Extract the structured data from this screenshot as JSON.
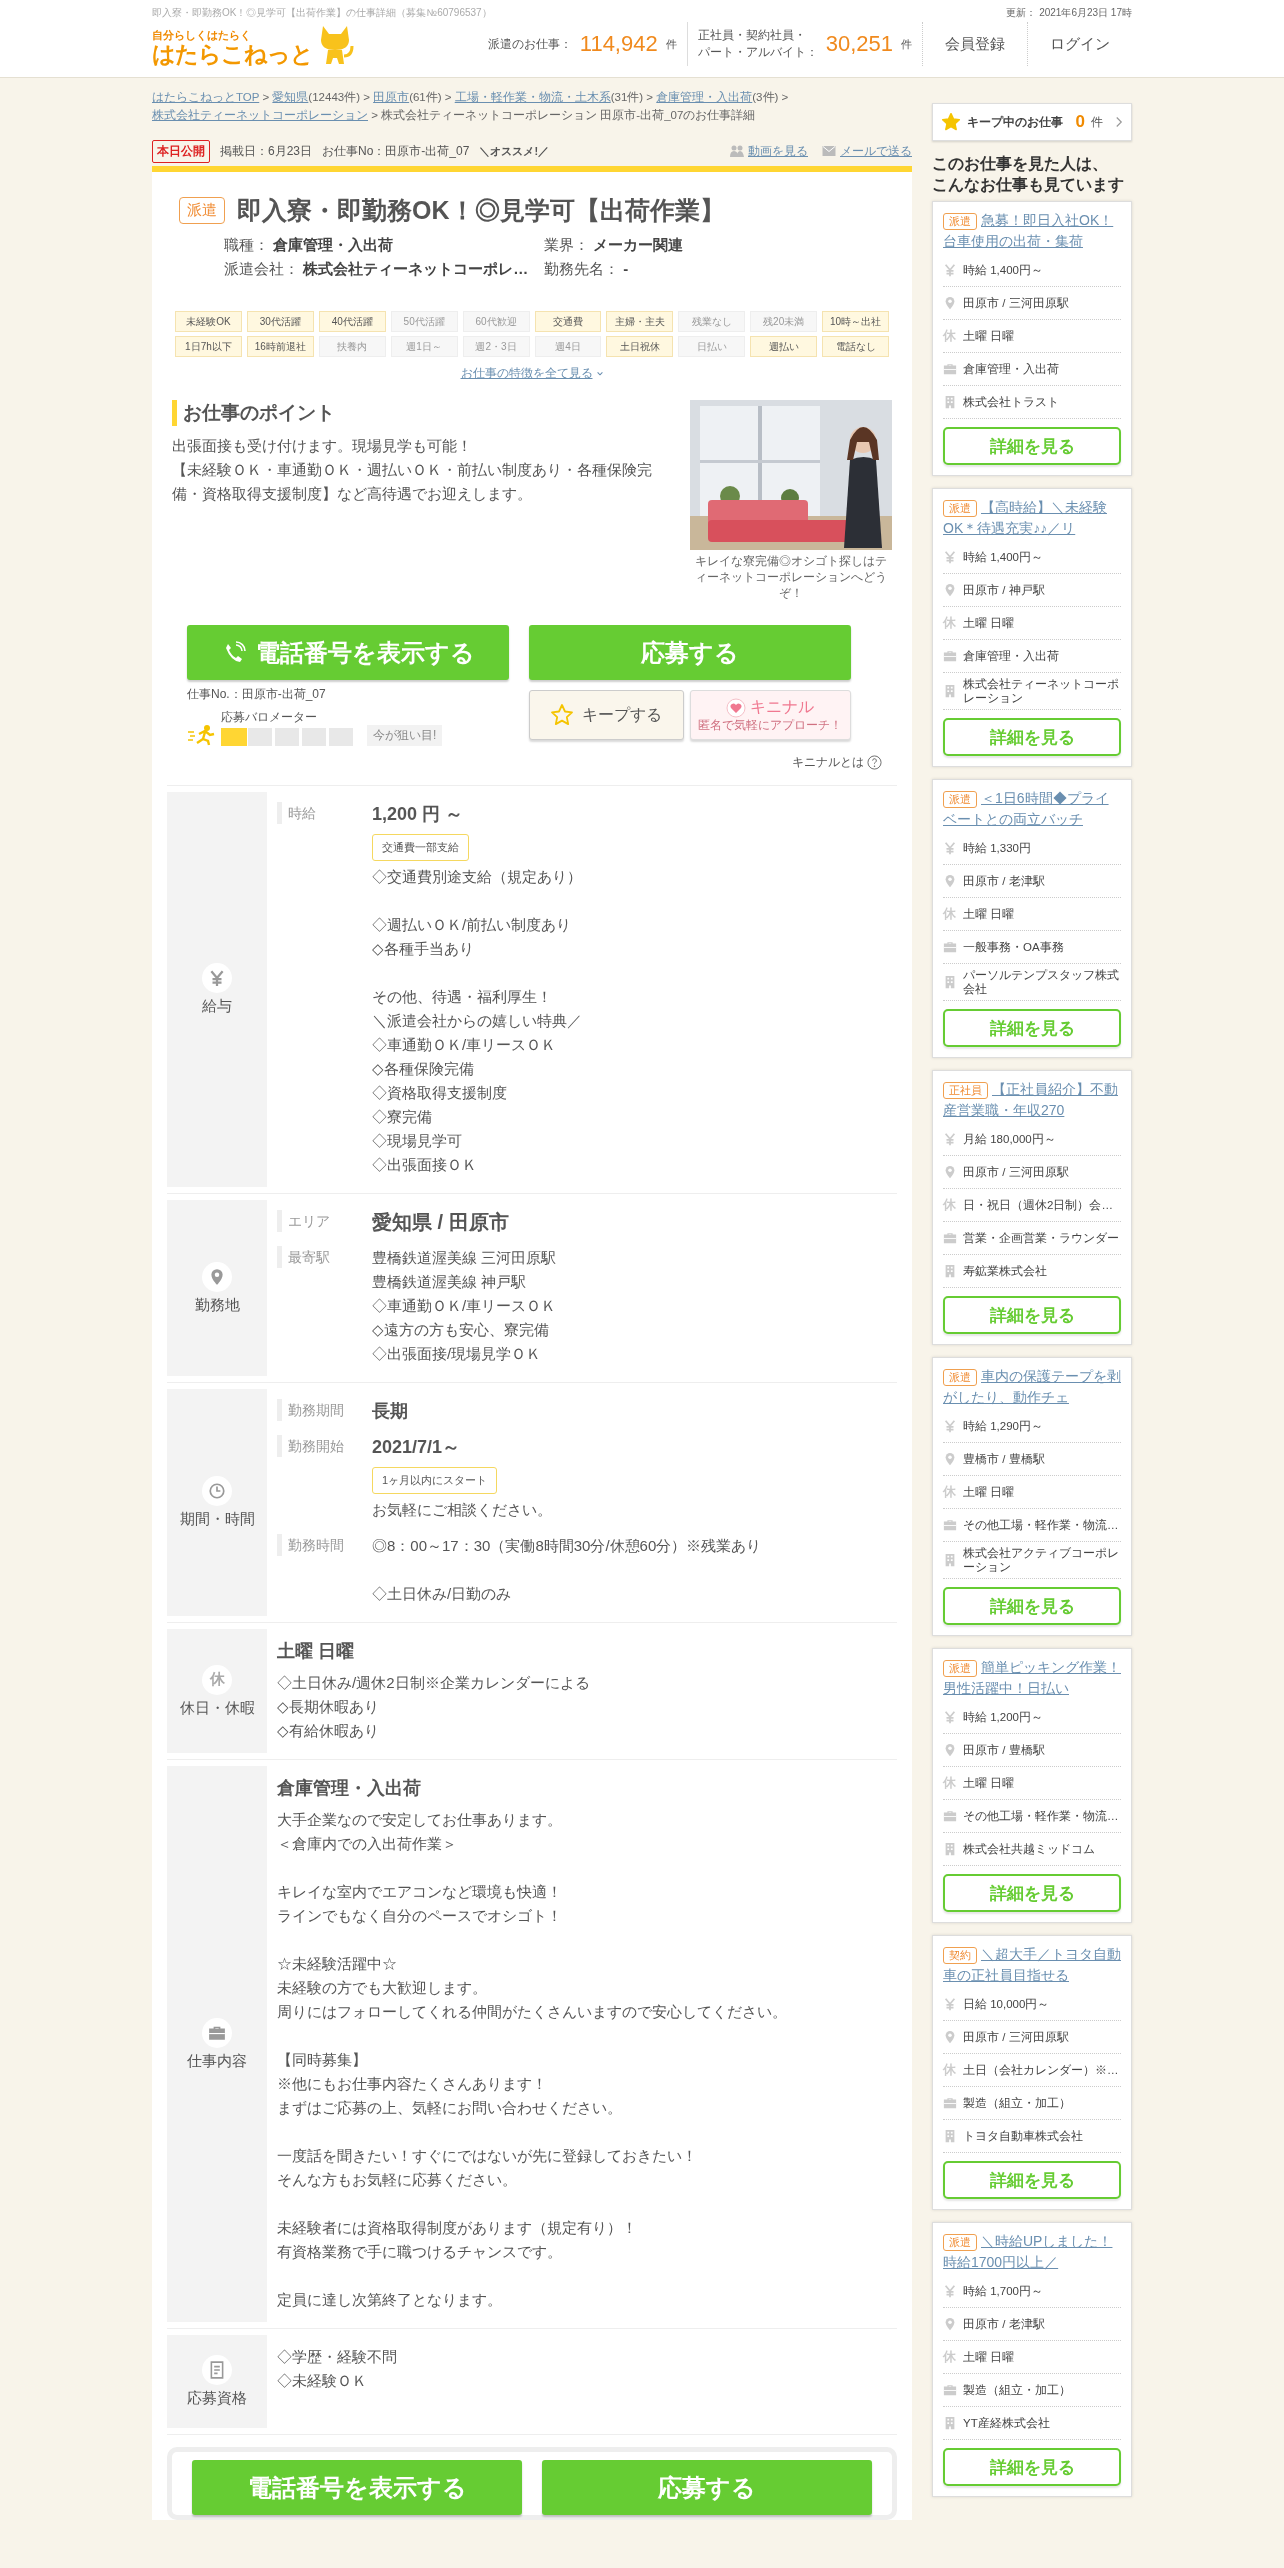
{
  "header": {
    "page_title": "即入寮・即勤務OK！◎見学可【出荷作業】の仕事詳細（募集№60796537）",
    "updated": "更新： 2021年6月23日 17時",
    "logo_tagline": "自分らしくはたらく",
    "logo_name": "はたらこねっと",
    "stats": [
      {
        "label": [
          "派遣のお仕事："
        ],
        "count": "114,942",
        "unit": "件"
      },
      {
        "label": [
          "正社員・契約社員・",
          "パート・アルバイト："
        ],
        "count": "30,251",
        "unit": "件"
      }
    ],
    "buttons": [
      "会員登録",
      "ログイン"
    ]
  },
  "breadcrumb": {
    "separator": ">",
    "links": [
      {
        "label": "はたらこねっとTOP"
      },
      {
        "label": "愛知県",
        "count": "(12443件)"
      },
      {
        "label": "田原市",
        "count": "(61件)"
      },
      {
        "label": "工場・軽作業・物流・土木系",
        "count": "(31件)"
      },
      {
        "label": "倉庫管理・入出荷",
        "count": "(3件)"
      },
      {
        "label": "株式会社ティーネットコーポレーション"
      }
    ],
    "current": "株式会社ティーネットコーポレーション 田原市-出荷_07のお仕事詳細"
  },
  "meta": {
    "badge": "本日公開",
    "posted": "掲載日：6月23日",
    "job_no": "お仕事No：田原市-出荷_07",
    "recommend": "＼オススメ!／",
    "links": [
      {
        "kind": "video",
        "label": "動画を見る"
      },
      {
        "kind": "mail",
        "label": "メールで送る"
      }
    ]
  },
  "job": {
    "tag": "派遣",
    "title": "即入寮・即勤務OK！◎見学可【出荷作業】",
    "fields": [
      {
        "label": "職種：",
        "value": "倉庫管理・入出荷"
      },
      {
        "label": "業界：",
        "value": "メーカー関連"
      },
      {
        "label": "派遣会社：",
        "value": "株式会社ティーネットコーポレ…"
      },
      {
        "label": "勤務先名：",
        "value": "-"
      }
    ],
    "features": [
      {
        "label": "未経験OK",
        "on": true
      },
      {
        "label": "30代活躍",
        "on": true
      },
      {
        "label": "40代活躍",
        "on": true
      },
      {
        "label": "50代活躍",
        "on": false
      },
      {
        "label": "60代歓迎",
        "on": false
      },
      {
        "label": "交通費",
        "on": true
      },
      {
        "label": "主婦・主夫",
        "on": true
      },
      {
        "label": "残業なし",
        "on": false
      },
      {
        "label": "残20未満",
        "on": false
      },
      {
        "label": "10時～出社",
        "on": true
      },
      {
        "label": "1日7h以下",
        "on": true
      },
      {
        "label": "16時前退社",
        "on": true
      },
      {
        "label": "扶養内",
        "on": false
      },
      {
        "label": "週1日～",
        "on": false
      },
      {
        "label": "週2・3日",
        "on": false
      },
      {
        "label": "週4日",
        "on": false
      },
      {
        "label": "土日祝休",
        "on": true
      },
      {
        "label": "日払い",
        "on": false
      },
      {
        "label": "週払い",
        "on": true
      },
      {
        "label": "電話なし",
        "on": true
      }
    ],
    "features_link": "お仕事の特徴を全て見る"
  },
  "points": {
    "heading": "お仕事のポイント",
    "lines": [
      "出張面接も受け付けます。現場見学も可能！",
      "【未経験ＯＫ・車通勤ＯＫ・週払いＯＫ・前払い制度あり・各種保険完備・資格取得支援制度】など高待遇でお迎えします。"
    ],
    "photo": {
      "kind": "picture"
    },
    "caption": "キレイな寮完備◎オシゴト探しはティーネットコーポレーションへどうぞ！"
  },
  "actions": {
    "phone": "電話番号を表示する",
    "apply": "応募する",
    "job_no": "仕事No.：田原市-出荷_07",
    "barometer": {
      "label": "応募バロメーター",
      "level": 0.2,
      "hint": "今が狙い目!"
    },
    "keep": "キープする",
    "kininaru": {
      "label": "キニナル",
      "sub": "匿名で気軽にアプローチ！"
    },
    "help": "キニナルとは"
  },
  "sections": [
    {
      "kind": "salary",
      "title": "給与",
      "rows": [
        {
          "label": "時給",
          "value": "1,200 円 ～",
          "badge": "交通費一部支給",
          "paragraphs": [
            [
              "◇交通費別途支給（規定あり）"
            ],
            [
              "◇週払いＯＫ/前払い制度あり",
              "◇各種手当あり"
            ],
            [
              "その他、待遇・福利厚生！",
              "＼派遣会社からの嬉しい特典／",
              "◇車通勤ＯＫ/車リースＯＫ",
              "◇各種保険完備",
              "◇資格取得支援制度",
              "◇寮完備",
              "◇現場見学可",
              "◇出張面接ＯＫ"
            ]
          ]
        }
      ]
    },
    {
      "kind": "location",
      "title": "勤務地",
      "rows": [
        {
          "label": "エリア",
          "value": "愛知県 / 田原市"
        },
        {
          "label": "最寄駅",
          "paragraphs": [
            [
              "豊橋鉄道渥美線 三河田原駅",
              "豊橋鉄道渥美線 神戸駅",
              "◇車通勤ＯＫ/車リースＯＫ",
              "◇遠方の方も安心、寮完備",
              "◇出張面接/現場見学ＯＫ"
            ]
          ]
        }
      ]
    },
    {
      "kind": "period",
      "title": "期間・時間",
      "rows": [
        {
          "label": "勤務期間",
          "value": "長期"
        },
        {
          "label": "勤務開始",
          "value": "2021/7/1～",
          "badge": "1ヶ月以内にスタート",
          "paragraphs": [
            [
              "お気軽にご相談ください。"
            ]
          ]
        },
        {
          "label": "勤務時間",
          "paragraphs": [
            [
              "◎8：00～17：30（実働8時間30分/休憩60分）※残業あり"
            ],
            [
              "◇土日休み/日勤のみ"
            ]
          ]
        }
      ]
    },
    {
      "kind": "holiday",
      "title": "休日・休暇",
      "icon_text": "休",
      "heading": "土曜 日曜",
      "paragraphs": [
        [
          "◇土日休み/週休2日制※企業カレンダーによる",
          "◇長期休暇あり",
          "◇有給休暇あり"
        ]
      ]
    },
    {
      "kind": "job",
      "title": "仕事内容",
      "heading": "倉庫管理・入出荷",
      "paragraphs": [
        [
          "大手企業なので安定してお仕事あります。",
          "＜倉庫内での入出荷作業＞"
        ],
        [
          "キレイな室内でエアコンなど環境も快適！",
          "ラインでもなく自分のペースでオシゴト！"
        ],
        [
          "☆未経験活躍中☆",
          "未経験の方でも大歓迎します。",
          "周りにはフォローしてくれる仲間がたくさんいますので安心してください。"
        ],
        [
          "【同時募集】",
          "※他にもお仕事内容たくさんあります！",
          "まずはご応募の上、気軽にお問い合わせください。"
        ],
        [
          "一度話を聞きたい！すぐにではないが先に登録しておきたい！",
          "そんな方もお気軽に応募ください。"
        ],
        [
          "未経験者には資格取得制度があります（規定有り）！",
          "有資格業務で手に職つけるチャンスです。"
        ],
        [
          "定員に達し次第終了となります。"
        ]
      ]
    },
    {
      "kind": "requirements",
      "title": "応募資格",
      "paragraphs": [
        [
          "◇学歴・経験不問",
          "◇未経験ＯＫ"
        ]
      ]
    }
  ],
  "bottom_actions": {
    "phone": "電話番号を表示する",
    "apply": "応募する"
  },
  "sidebar": {
    "keep": {
      "label": "キープ中のお仕事",
      "count": "0",
      "unit": "件"
    },
    "heading": [
      "このお仕事を見た人は、",
      "こんなお仕事も見ています"
    ],
    "jobs": [
      {
        "tag": "派遣",
        "title": "急募！即日入社OK！台車使用の出荷・集荷",
        "wage": "時給 1,400円～",
        "location": "田原市 / 三河田原駅",
        "holiday_mark": "休",
        "holiday": "土曜 日曜",
        "category": "倉庫管理・入出荷",
        "company": "株式会社トラスト",
        "button": "詳細を見る"
      },
      {
        "tag": "派遣",
        "title": "【高時給】＼未経験OK＊待遇充実♪♪／リ",
        "wage": "時給 1,400円～",
        "location": "田原市 / 神戸駅",
        "holiday_mark": "休",
        "holiday": "土曜 日曜",
        "category": "倉庫管理・入出荷",
        "company": "株式会社ティーネットコーポレーション",
        "button": "詳細を見る"
      },
      {
        "tag": "派遣",
        "title": "＜1日6時間◆プライベートとの両立バッチ",
        "wage": "時給 1,330円",
        "location": "田原市 / 老津駅",
        "holiday_mark": "休",
        "holiday": "土曜 日曜",
        "category": "一般事務・OA事務",
        "company": "パーソルテンプスタッフ株式会社",
        "button": "詳細を見る"
      },
      {
        "tag": "正社員",
        "title": "【正社員紹介】不動産営業職・年収270",
        "wage": "月給 180,000円～",
        "location": "田原市 / 三河田原駅",
        "holiday_mark": "休",
        "holiday": "日・祝日（週休2日制）会…",
        "category": "営業・企画営業・ラウンダー",
        "company": "寿鉱業株式会社",
        "button": "詳細を見る"
      },
      {
        "tag": "派遣",
        "title": "車内の保護テープを剥がしたり、動作チェ",
        "wage": "時給 1,290円～",
        "location": "豊橋市 / 豊橋駅",
        "holiday_mark": "休",
        "holiday": "土曜 日曜",
        "category": "その他工場・軽作業・物流…",
        "company": "株式会社アクティブコーポレーション",
        "button": "詳細を見る"
      },
      {
        "tag": "派遣",
        "title": "簡単ピッキング作業！男性活躍中！日払い",
        "wage": "時給 1,200円～",
        "location": "田原市 / 豊橋駅",
        "holiday_mark": "休",
        "holiday": "土曜 日曜",
        "category": "その他工場・軽作業・物流…",
        "company": "株式会社共越ミッドコム",
        "button": "詳細を見る"
      },
      {
        "tag": "契約",
        "title": "＼超大手／トヨタ自動車の正社員目指せる",
        "wage": "日給 10,000円～",
        "location": "田原市 / 三河田原駅",
        "holiday_mark": "休",
        "holiday": "土日（会社カレンダー）※…",
        "category": "製造（組立・加工）",
        "company": "トヨタ自動車株式会社",
        "button": "詳細を見る"
      },
      {
        "tag": "派遣",
        "title": "＼時給UPしました！時給1700円以上／",
        "wage": "時給 1,700円～",
        "location": "田原市 / 老津駅",
        "holiday_mark": "休",
        "holiday": "土曜 日曜",
        "category": "製造（組立・加工）",
        "company": "YT産経株式会社",
        "button": "詳細を見る"
      }
    ]
  }
}
